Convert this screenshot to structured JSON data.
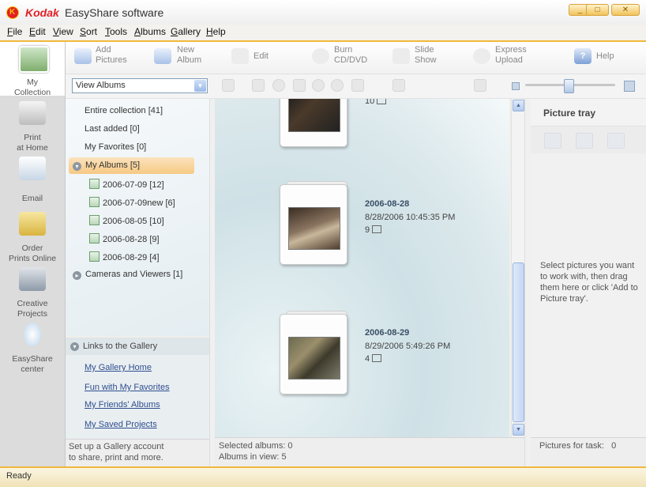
{
  "window": {
    "brand": "Kodak",
    "title": "EasyShare software",
    "controls": [
      "_",
      "□",
      "✕"
    ]
  },
  "menu": [
    "File",
    "Edit",
    "View",
    "Sort",
    "Tools",
    "Albums",
    "Gallery",
    "Help"
  ],
  "nav": [
    {
      "label1": "My",
      "label2": "Collection"
    },
    {
      "label1": "Print",
      "label2": "at Home"
    },
    {
      "label1": "Email",
      "label2": ""
    },
    {
      "label1": "Order",
      "label2": "Prints Online"
    },
    {
      "label1": "Creative",
      "label2": "Projects"
    },
    {
      "label1": "EasyShare",
      "label2": "center"
    }
  ],
  "toolbar": [
    {
      "l1": "Add",
      "l2": "Pictures"
    },
    {
      "l1": "New",
      "l2": "Album"
    },
    {
      "l1": "Edit",
      "l2": ""
    },
    {
      "l1": "Burn",
      "l2": "CD/DVD"
    },
    {
      "l1": "Slide",
      "l2": "Show"
    },
    {
      "l1": "Express",
      "l2": "Upload"
    },
    {
      "l1": "Help",
      "l2": ""
    }
  ],
  "view_select": {
    "value": "View Albums"
  },
  "zoom_slider": {
    "level": 0.48
  },
  "tree": {
    "entire": "Entire collection [41]",
    "last_added": "Last added [0]",
    "favorites": "My Favorites [0]",
    "my_albums": "My Albums [5]",
    "albums": [
      "2006-07-09 [12]",
      "2006-07-09new [6]",
      "2006-08-05 [10]",
      "2006-08-28 [9]",
      "2006-08-29 [4]"
    ],
    "cameras": "Cameras and Viewers [1]"
  },
  "links": {
    "header": "Links to the Gallery",
    "items": [
      "My Gallery Home",
      "Fun with My Favorites",
      "My Friends' Albums",
      "My Saved Projects"
    ]
  },
  "gallery_promo": {
    "line1": "Set up a Gallery account",
    "line2": "to share, print and more."
  },
  "albums_view": [
    {
      "title": "",
      "date": "",
      "count": "10"
    },
    {
      "title": "2006-08-28",
      "date": "8/28/2006 10:45:35 PM",
      "count": "9"
    },
    {
      "title": "2006-08-29",
      "date": "8/29/2006 5:49:26 PM",
      "count": "4"
    }
  ],
  "main_status": {
    "selected": "Selected albums: 0",
    "in_view": "Albums in view: 5"
  },
  "tray": {
    "title": "Picture tray",
    "hint": "Select pictures you want to work with, then drag them here or click 'Add to Picture tray'.",
    "status": "Pictures for task:   0"
  },
  "statusbar": {
    "text": "Ready"
  }
}
